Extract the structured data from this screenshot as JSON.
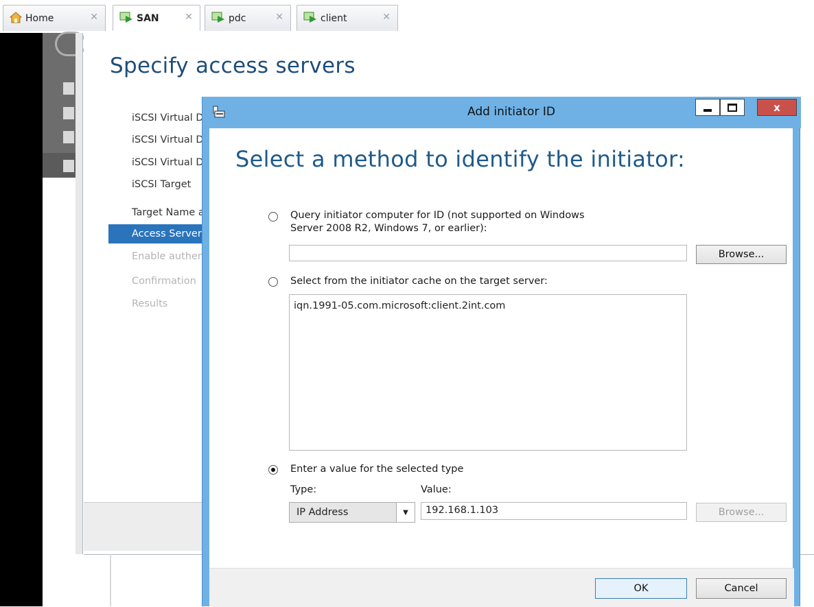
{
  "tabs": [
    {
      "label": "Home",
      "icon": "home-icon",
      "active": false
    },
    {
      "label": "SAN",
      "icon": "vm-icon",
      "active": true
    },
    {
      "label": "pdc",
      "icon": "vm-icon",
      "active": false
    },
    {
      "label": "client",
      "icon": "vm-icon",
      "active": false
    }
  ],
  "wizard": {
    "title": "Specify access servers",
    "steps": [
      {
        "label": "iSCSI Virtual Disk Location",
        "state": "normal"
      },
      {
        "label": "iSCSI Virtual Disk Name",
        "state": "normal"
      },
      {
        "label": "iSCSI Virtual Disk Size",
        "state": "normal"
      },
      {
        "label": "iSCSI Target",
        "state": "normal"
      },
      {
        "label": "Target Name and Access",
        "state": "normal"
      },
      {
        "label": "Access Servers",
        "state": "selected"
      },
      {
        "label": "Enable authentication",
        "state": "disabled"
      },
      {
        "label": "Confirmation",
        "state": "disabled"
      },
      {
        "label": "Results",
        "state": "disabled"
      }
    ]
  },
  "dialog": {
    "title": "Add initiator ID",
    "heading": "Select a method to identify the initiator:",
    "option_query_line1": "Query initiator computer for ID (not supported on Windows",
    "option_query_line2": "Server 2008 R2, Windows 7, or earlier):",
    "query_value": "",
    "browse_label": "Browse...",
    "option_cache": "Select from the initiator cache on the target server:",
    "cache_items": [
      "iqn.1991-05.com.microsoft:client.2int.com"
    ],
    "option_enter": "Enter a value for the selected type",
    "type_label": "Type:",
    "value_label": "Value:",
    "type_selected": "IP Address",
    "value": "192.168.1.103",
    "browse2_label": "Browse...",
    "ok_label": "OK",
    "cancel_label": "Cancel",
    "selected_option": "enter",
    "close_symbol": "x"
  },
  "colors": {
    "titlebar": "#6fb1e5",
    "selected_step": "#2a74bc",
    "heading": "#1e5a8a",
    "close": "#c9514b"
  }
}
